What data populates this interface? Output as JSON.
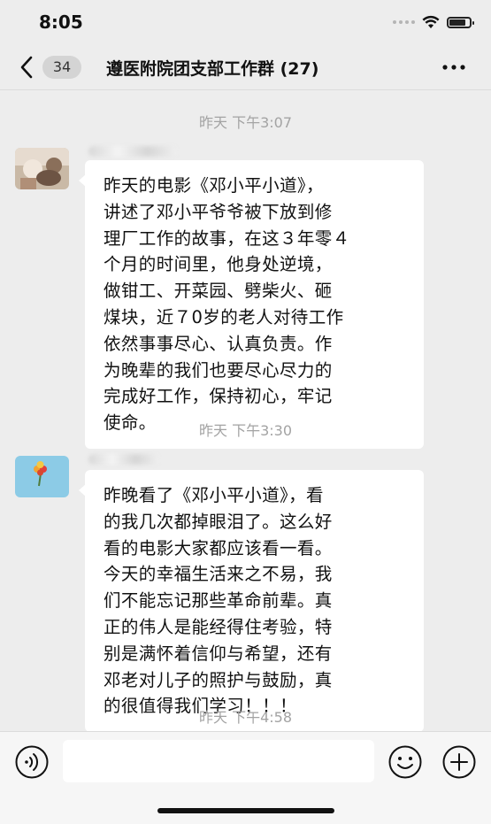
{
  "status_bar": {
    "time": "8:05",
    "battery_level": 0.8
  },
  "nav": {
    "unread_count": "34",
    "title": "遵医附院团支部工作群 (27)"
  },
  "messages": [
    {
      "timestamp": "昨天 下午3:07",
      "text": "昨天的电影《邓小平小道》，\n讲述了邓小平爷爷被下放到修\n理厂工作的故事，在这３年零４\n个月的时间里，他身处逆境，\n做钳工、开菜园、劈柴火、砸\n煤块，近７0岁的老人对待工作\n依然事事尽心、认真负责。作\n为晚辈的我们也要尽心尽力的\n完成好工作，保持初心，牢记\n使命。",
      "avatar_icon": "photo-avatar"
    },
    {
      "timestamp": "昨天 下午3:30",
      "text": "昨晚看了《邓小平小道》，看\n的我几次都掉眼泪了。这么好\n看的电影大家都应该看一看。\n今天的幸福生活来之不易，我\n们不能忘记那些革命前辈。真\n正的伟人是能经得住考验，特\n别是满怀着信仰与希望，还有\n邓老对儿子的照护与鼓励，真\n的很值得我们学习！！！",
      "avatar_icon": "flower-avatar"
    },
    {
      "timestamp": "昨天 下午4:58"
    }
  ],
  "input_bar": {
    "voice_icon": "voice-icon",
    "emoji_icon": "emoji-icon",
    "plus_icon": "plus-icon",
    "input_value": ""
  },
  "colors": {
    "background": "#ededed",
    "bubble": "#ffffff",
    "timestamp": "#a3a3a3"
  }
}
